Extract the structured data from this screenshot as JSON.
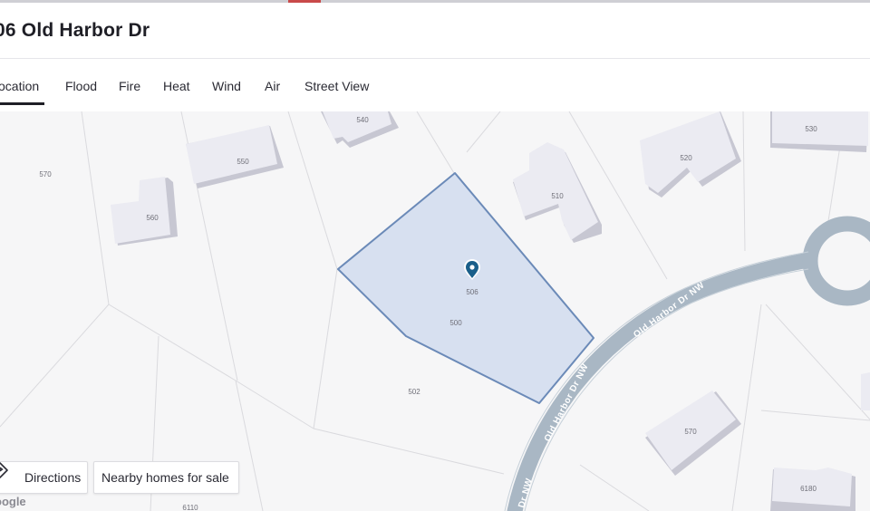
{
  "header": {
    "title": "06 Old Harbor Dr"
  },
  "tabs": [
    {
      "label": "ocation",
      "active": true
    },
    {
      "label": "Flood"
    },
    {
      "label": "Fire"
    },
    {
      "label": "Heat"
    },
    {
      "label": "Wind"
    },
    {
      "label": "Air"
    },
    {
      "label": "Street View"
    }
  ],
  "map": {
    "lot_labels": {
      "l570a": "570",
      "l560": "560",
      "l550": "550",
      "l540": "540",
      "l510": "510",
      "l520": "520",
      "l530": "530",
      "l506": "506",
      "l500": "500",
      "l502": "502",
      "l570b": "570",
      "l6180": "6180",
      "l6110": "6110"
    },
    "street_label_top": "Old Harbor Dr NW",
    "street_label_mid": "Old Harbor Dr NW",
    "street_label_low": "Dr NW",
    "attribution": "oogle",
    "colors": {
      "selected_fill": "#d7e0f0",
      "selected_stroke": "#6b8ab8",
      "road": "#a9b7c4",
      "pin": "#1a5f8a"
    }
  },
  "buttons": {
    "directions": "Directions",
    "nearby": "Nearby homes for sale"
  },
  "icons": {
    "directions": "directions-diamond-icon",
    "pin": "map-pin-icon"
  }
}
